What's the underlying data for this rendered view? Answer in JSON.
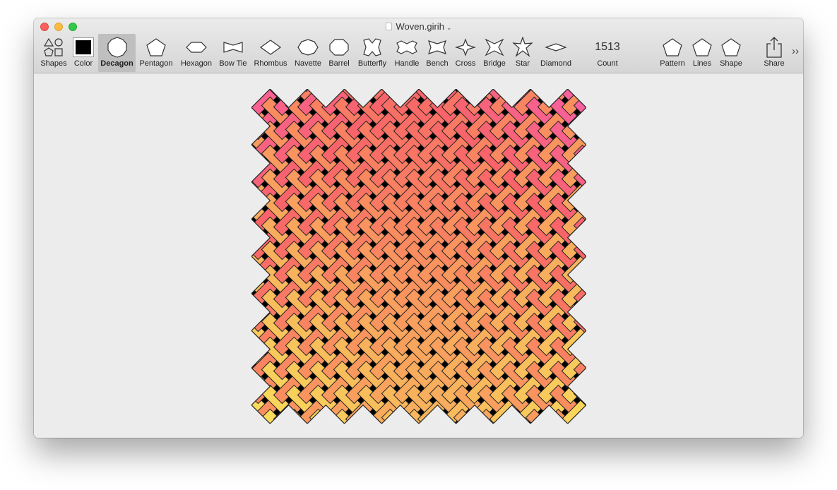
{
  "window": {
    "title": "Woven.girih",
    "title_chevron": "⌄"
  },
  "toolbar": {
    "items": [
      {
        "label": "Shapes",
        "icon": "shapes-icon"
      },
      {
        "label": "Color",
        "icon": "color-swatch-icon"
      },
      {
        "label": "Decagon",
        "icon": "decagon-icon",
        "selected": true
      },
      {
        "label": "Pentagon",
        "icon": "pentagon-icon"
      },
      {
        "label": "Hexagon",
        "icon": "hexagon-icon"
      },
      {
        "label": "Bow Tie",
        "icon": "bow-tie-icon"
      },
      {
        "label": "Rhombus",
        "icon": "rhombus-icon"
      },
      {
        "label": "Navette",
        "icon": "navette-icon"
      },
      {
        "label": "Barrel",
        "icon": "barrel-icon"
      },
      {
        "label": "Butterfly",
        "icon": "butterfly-icon"
      },
      {
        "label": "Handle",
        "icon": "handle-icon"
      },
      {
        "label": "Bench",
        "icon": "bench-icon"
      },
      {
        "label": "Cross",
        "icon": "cross-icon"
      },
      {
        "label": "Bridge",
        "icon": "bridge-icon"
      },
      {
        "label": "Star",
        "icon": "star-icon"
      },
      {
        "label": "Diamond",
        "icon": "diamond-icon"
      }
    ],
    "count": {
      "label": "Count",
      "value": "1513"
    },
    "right_items": [
      {
        "label": "Pattern",
        "icon": "pentagon-icon"
      },
      {
        "label": "Lines",
        "icon": "pentagon-icon"
      },
      {
        "label": "Shape",
        "icon": "pentagon-icon"
      },
      {
        "label": "Share",
        "icon": "share-icon"
      }
    ],
    "overflow": "››"
  },
  "colors": {
    "gradient": [
      "#f95fa6",
      "#f86468",
      "#f98e5f",
      "#f8b85c",
      "#f9e25b"
    ],
    "selected_color": "#000000",
    "canvas_bg": "#ececec"
  }
}
